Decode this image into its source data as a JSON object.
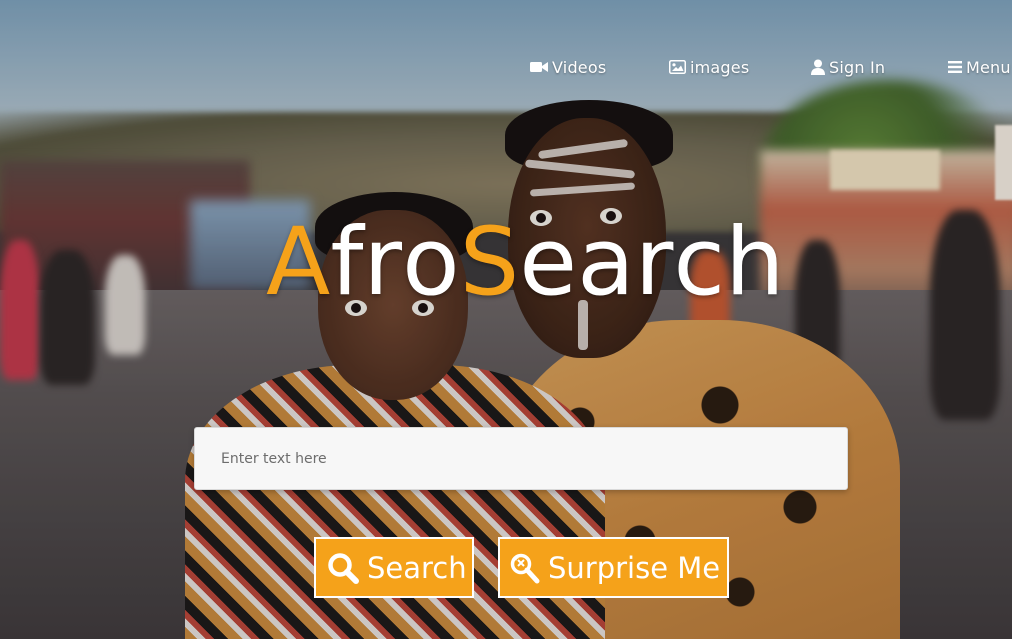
{
  "nav": {
    "videos": {
      "label": "Videos",
      "icon": "video-camera-icon"
    },
    "images": {
      "label": "images",
      "icon": "image-icon"
    },
    "signin": {
      "label": "Sign In",
      "icon": "user-icon"
    },
    "menu": {
      "label": "Menu",
      "icon": "hamburger-icon"
    }
  },
  "logo": {
    "letters": [
      {
        "char": "A",
        "color": "accent"
      },
      {
        "char": "f",
        "color": "white"
      },
      {
        "char": "r",
        "color": "white"
      },
      {
        "char": "o",
        "color": "white"
      },
      {
        "char": "S",
        "color": "accent"
      },
      {
        "char": "e",
        "color": "white"
      },
      {
        "char": "a",
        "color": "white"
      },
      {
        "char": "r",
        "color": "white"
      },
      {
        "char": "c",
        "color": "white"
      },
      {
        "char": "h",
        "color": "white"
      }
    ]
  },
  "search": {
    "placeholder": "Enter text here",
    "value": ""
  },
  "buttons": {
    "search": {
      "label": "Search",
      "icon": "magnifier-icon"
    },
    "surprise": {
      "label": "Surprise Me",
      "icon": "magic-search-icon"
    }
  },
  "colors": {
    "accent": "#f5a21a",
    "white": "#ffffff"
  }
}
